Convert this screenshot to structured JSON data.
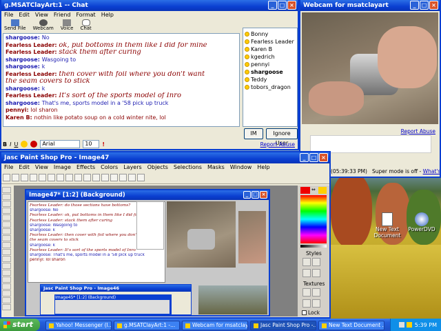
{
  "chat_window": {
    "title": "g.MSATClayArt:1 -- Chat",
    "menu": [
      "File",
      "Edit",
      "View",
      "Friend",
      "Format",
      "Help"
    ],
    "toolbar": [
      "Send File",
      "Webcam",
      "Voice",
      "Chat"
    ],
    "messages": [
      {
        "user": "shargoose:",
        "text": "No",
        "style": "sg"
      },
      {
        "user": "Fearless Leader:",
        "text": "ok, put bottoms in them like I did for mine",
        "style": "fl"
      },
      {
        "user": "Fearless Leader:",
        "text": "stack them after curing",
        "style": "fl"
      },
      {
        "user": "shargoose:",
        "text": "Wasgoing to",
        "style": "sg"
      },
      {
        "user": "shargoose:",
        "text": "k",
        "style": "sg"
      },
      {
        "user": "Fearless Leader:",
        "text": "then cover with foil where you don't want",
        "style": "fl"
      },
      {
        "user": "",
        "text": "the seam covers to stick",
        "style": "flcont"
      },
      {
        "user": "shargoose:",
        "text": "k",
        "style": "sg"
      },
      {
        "user": "Fearless Leader:",
        "text": "It's sort of the sports model of Inro",
        "style": "fl"
      },
      {
        "user": "shargoose:",
        "text": "That's me, sports model in a '58 pick up truck",
        "style": "sg"
      },
      {
        "user": "pennyi:",
        "text": "lol sharon",
        "style": "pn"
      },
      {
        "user": "Karen B:",
        "text": "nothin like potato soup on a cold winter nite, lol",
        "style": "pn"
      }
    ],
    "users": [
      "Bonny",
      "Fearless Leader",
      "Karen B",
      "kgedrich",
      "pennyi",
      "shargoose",
      "Teddy",
      "tobors_dragon"
    ],
    "im_button": "IM",
    "ignore_button": "Ignore User",
    "font_name": "Arial",
    "font_size": "10",
    "report_abuse": "Report Abuse",
    "format_buttons": [
      "B",
      "I",
      "U"
    ]
  },
  "webcam_window": {
    "title": "Webcam for msatclayart",
    "report_abuse": "Report Abuse",
    "timestamp": "(05:39:33 PM)",
    "super_mode": "Super mode is off -",
    "whats_this": "What's this?"
  },
  "psp_window": {
    "title": "Jasc Paint Shop Pro - Image47",
    "menu": [
      "File",
      "Edit",
      "View",
      "Image",
      "Effects",
      "Colors",
      "Layers",
      "Objects",
      "Selections",
      "Masks",
      "Window",
      "Help"
    ],
    "image_title": "Image47* [1:2] (Background)",
    "styles_label": "Styles",
    "textures_label": "Textures",
    "lock_label": "Lock",
    "inner_lines": [
      "Fearless Leader: do those sections have bottoms?",
      "shargoose: No",
      "Fearless Leader: ok, put bottoms in them like I did for mine",
      "Fearless Leader: stack them after curing",
      "shargoose: Wasgoing to",
      "shargoose: k",
      "Fearless Leader: then cover with foil where you don't want",
      "the seam covers to stick",
      "shargoose: k",
      "Fearless Leader: It's sort of the sports model of Inro",
      "shargoose: That's me, sports model in a '58 pick up truck",
      "pennyi: lol sharon"
    ],
    "nested_title": "Jasc Paint Shop Pro - Image46",
    "nested_image_title": "Image45* [1:2] (Background)"
  },
  "desktop": {
    "icons": [
      "New Text Document",
      "PowerDVD"
    ]
  },
  "taskbar": {
    "start": "start",
    "tasks": [
      "Yahoo! Messenger (I...",
      "g.MSATClayArt:1 -...",
      "Webcam for msatclay...",
      "Jasc Paint Shop Pro -...",
      "New Text Document ..."
    ],
    "active_index": 3,
    "clock": "5:39 PM"
  },
  "colors": {
    "xp_blue": "#0a3fd1",
    "fearless": "#8b0000",
    "shargoose": "#1a1ab0",
    "start_green": "#3c9a3c"
  }
}
